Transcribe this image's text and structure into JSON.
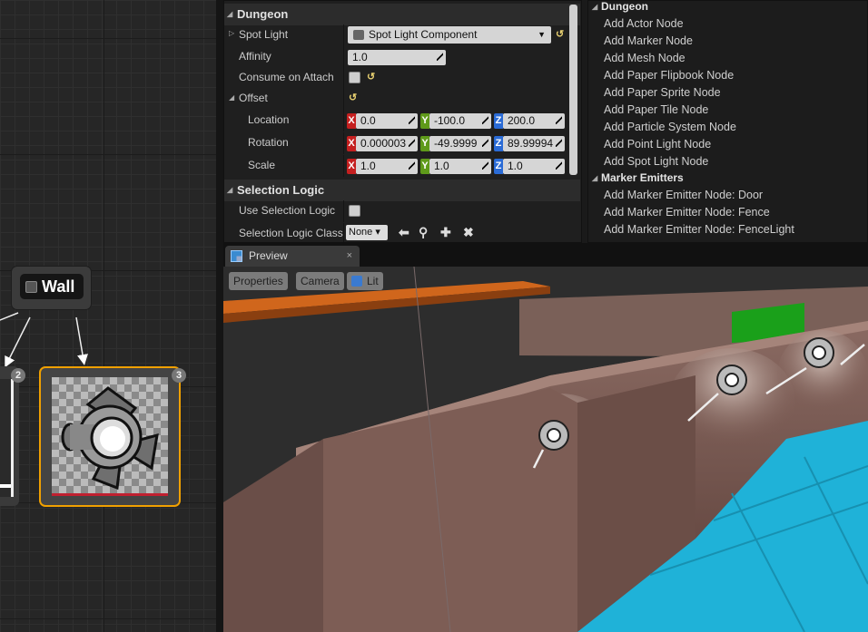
{
  "graph": {
    "wall_node_label": "Wall",
    "badge_left": "2",
    "badge_selected": "3"
  },
  "details": {
    "section_dungeon": "Dungeon",
    "spot_light_label": "Spot Light",
    "spot_light_value": "Spot Light Component",
    "affinity_label": "Affinity",
    "affinity_value": "1.0",
    "consume_label": "Consume on Attach",
    "offset_label": "Offset",
    "location_label": "Location",
    "location": {
      "x": "0.0",
      "y": "-100.0",
      "z": "200.0"
    },
    "rotation_label": "Rotation",
    "rotation": {
      "x": "0.000003",
      "y": "-49.9999",
      "z": "89.99994"
    },
    "scale_label": "Scale",
    "scale": {
      "x": "1.0",
      "y": "1.0",
      "z": "1.0"
    },
    "axis_x": "X",
    "axis_y": "Y",
    "axis_z": "Z",
    "section_selection": "Selection Logic",
    "use_selection_label": "Use Selection Logic",
    "selection_class_label": "Selection Logic Class",
    "selection_class_value": "None"
  },
  "palette": {
    "cat_dungeon": "Dungeon",
    "dungeon_items": [
      "Add Actor Node",
      "Add Marker Node",
      "Add Mesh Node",
      "Add Paper Flipbook Node",
      "Add Paper Sprite Node",
      "Add Paper Tile Node",
      "Add Particle System Node",
      "Add Point Light Node",
      "Add Spot Light Node"
    ],
    "cat_emitters": "Marker Emitters",
    "emitter_items": [
      "Add Marker Emitter Node: Door",
      "Add Marker Emitter Node: Fence",
      "Add Marker Emitter Node: FenceLight"
    ]
  },
  "preview": {
    "tab_label": "Preview",
    "close_glyph": "×",
    "btn_properties": "Properties",
    "btn_camera": "Camera",
    "btn_lit": "Lit"
  },
  "colors": {
    "selected_border": "#f0a000",
    "floor_blue": "#1fb2d8",
    "wall_brown": "#7a5a52"
  }
}
